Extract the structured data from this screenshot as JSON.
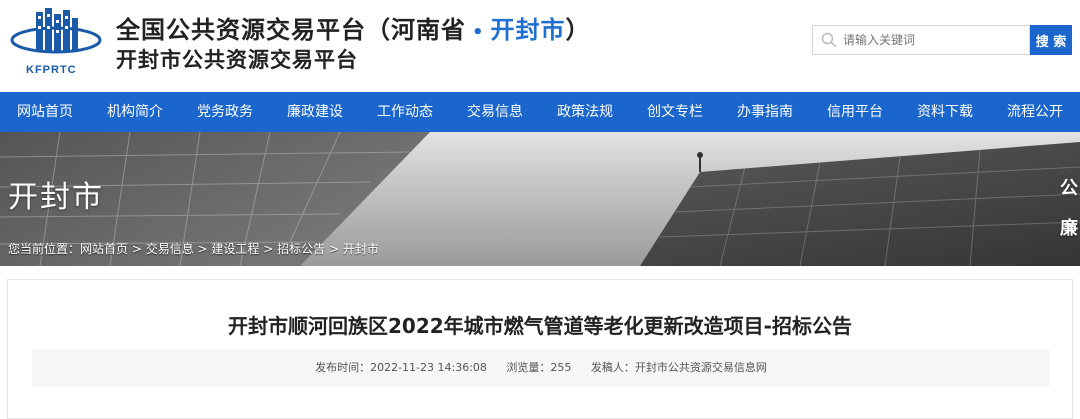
{
  "header": {
    "logo_text": "KFPRTC",
    "title_main": "全国公共资源交易平台（河南省",
    "title_dot": "•",
    "title_city": "开封市",
    "title_end": "）",
    "subtitle": "开封市公共资源交易平台"
  },
  "search": {
    "placeholder": "请输入关键词",
    "button_label": "搜 索"
  },
  "nav": {
    "items": [
      "网站首页",
      "机构简介",
      "党务政务",
      "廉政建设",
      "工作动态",
      "交易信息",
      "政策法规",
      "创文专栏",
      "办事指南",
      "信用平台",
      "资料下载",
      "流程公开"
    ]
  },
  "banner": {
    "title": "开封市",
    "breadcrumb_prefix": "您当前位置：",
    "breadcrumb": [
      "网站首页",
      "交易信息",
      "建设工程",
      "招标公告",
      "开封市"
    ],
    "side_chars": [
      "公",
      "廉"
    ]
  },
  "article": {
    "title": "开封市顺河回族区2022年城市燃气管道等老化更新改造项目-招标公告",
    "publish_label": "发布时间：",
    "publish_time": "2022-11-23 14:36:08",
    "views_label": "浏览量：",
    "views": "255",
    "author_label": "发稿人：",
    "author": "开封市公共资源交易信息网"
  },
  "colors": {
    "primary_blue": "#1a66cc",
    "accent_blue": "#1e6fd0"
  }
}
